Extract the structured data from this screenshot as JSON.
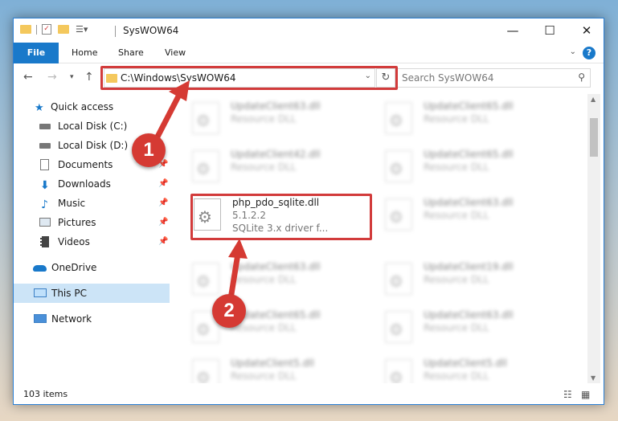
{
  "window": {
    "title": "SysWOW64",
    "minimize": "—",
    "maximize": "☐",
    "close": "✕"
  },
  "ribbon": {
    "tabs": [
      {
        "label": "File"
      },
      {
        "label": "Home"
      },
      {
        "label": "Share"
      },
      {
        "label": "View"
      }
    ],
    "help": "?"
  },
  "address": {
    "path": "C:\\Windows\\SysWOW64",
    "search_placeholder": "Search SysWOW64"
  },
  "sidebar": {
    "items": [
      {
        "label": "Quick access",
        "icon": "star-icon"
      },
      {
        "label": "Local Disk (C:)",
        "icon": "drive-icon"
      },
      {
        "label": "Local Disk (D:)",
        "icon": "drive-icon"
      },
      {
        "label": "Documents",
        "icon": "documents-icon"
      },
      {
        "label": "Downloads",
        "icon": "download-icon"
      },
      {
        "label": "Music",
        "icon": "music-icon"
      },
      {
        "label": "Pictures",
        "icon": "pictures-icon"
      },
      {
        "label": "Videos",
        "icon": "videos-icon"
      },
      {
        "label": "OneDrive",
        "icon": "cloud-icon"
      },
      {
        "label": "This PC",
        "icon": "computer-icon",
        "selected": true
      },
      {
        "label": "Network",
        "icon": "network-icon"
      }
    ]
  },
  "files": {
    "highlighted": {
      "name": "php_pdo_sqlite.dll",
      "version": "5.1.2.2",
      "desc": "SQLite 3.x driver f..."
    },
    "blurred": [
      {
        "name": "UpdateClient63.dll",
        "type": "Resource DLL"
      },
      {
        "name": "UpdateClient65.dll",
        "type": "Resource DLL"
      },
      {
        "name": "UpdateClient42.dll",
        "type": "Resource DLL"
      },
      {
        "name": "UpdateClient65.dll",
        "type": "Resource DLL"
      },
      {
        "name": "UpdateClient63.dll",
        "type": "Resource DLL"
      },
      {
        "name": "UpdateClient63.dll",
        "type": "Resource DLL"
      },
      {
        "name": "UpdateClient19.dll",
        "type": "Resource DLL"
      },
      {
        "name": "UpdateClient65.dll",
        "type": "Resource DLL"
      },
      {
        "name": "UpdateClient63.dll",
        "type": "Resource DLL"
      },
      {
        "name": "UpdateClient5.dll",
        "type": "Resource DLL"
      },
      {
        "name": "UpdateClient5.dll",
        "type": "Resource DLL"
      }
    ]
  },
  "status": {
    "count": "103 items"
  },
  "annotations": {
    "badge1": "1",
    "badge2": "2"
  },
  "colors": {
    "accent": "#1979ca",
    "highlight": "#d23b3b",
    "selected": "#cce4f7"
  }
}
